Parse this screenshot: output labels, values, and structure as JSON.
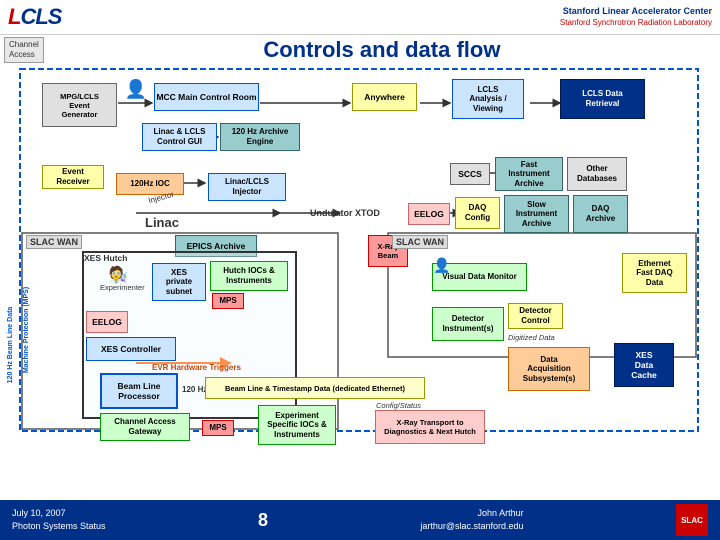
{
  "header": {
    "logo_text": "LCLS",
    "slac_line1": "Stanford Linear Accelerator Center",
    "slac_line2": "Stanford Synchrotron Radiation Laboratory"
  },
  "channel_access_label": "Channel\nAccess",
  "page_title": "Controls and data flow",
  "diagram": {
    "boxes": {
      "mpg_lcls": "MPG/LCLS\nEvent\nGenerator",
      "mcc_main": "MCC Main Control Room",
      "anywhere": "Anywhere",
      "lcls_analysis": "LCLS\nAnalysis /\nViewing",
      "lcls_data_retrieval": "LCLS Data\nRetrieval",
      "linac_lcls_gui": "Linac & LCLS\nControl GUI",
      "archive_engine": "120 Hz Archive\nEngine",
      "event_receiver": "Event\nReceiver",
      "injector": "Injector",
      "ioc_120hz": "120Hz IOC",
      "linac_lcls_injector": "Linac/LCLS\nInjector",
      "sccs": "SCCS",
      "fast_instrument_archive": "Fast\nInstrument\nArchive",
      "other_databases": "Other\nDatabases",
      "eelog": "EELOG",
      "daq_config": "DAQ\nConfig",
      "slow_instrument_archive": "Slow\nInstrument\nArchive",
      "daq_archive": "DAQ\nArchive",
      "linac_label": "Linac",
      "undulator_xtod": "Undulator XTOD",
      "epics_archive": "EPICS Archive",
      "xray_beam": "X-Ray\nBeam",
      "slac_wan_left": "SLAC WAN",
      "slac_wan_right": "SLAC WAN",
      "xes_hutch": "XES Hutch",
      "experimenter": "Experimenter",
      "xes_private_subnet": "XES\nprivate\nsubnet",
      "hutch_iocs": "Hutch IOCs &\nInstruments",
      "mps_top": "MPS",
      "mps_bottom": "MPS",
      "visual_data_monitor": "Visual Data Monitor",
      "ethernet_fast_daq": "Ethernet\nFast DAQ\nData",
      "eelog2": "EELOG",
      "xes_controller": "XES Controller",
      "evr_hardware_triggers": "EVR Hardware Triggers",
      "detector_instruments": "Detector\nInstrument(s)",
      "detector_control": "Detector\nControl",
      "digitized_data": "Digitized\nData",
      "data_acquisition": "Data\nAcquisition\nSubsystem(s)",
      "xes_data_cache": "XES\nData\nCache",
      "beam_line_processor": "Beam Line\nProcessor",
      "120hz_label": "120 Hz",
      "beam_line_timestamp": "Beam Line & Timestamp Data (dedicated Ethernet)",
      "channel_access_gateway": "Channel Access\nGateway",
      "experiment_specific": "Experiment\nSpecific IOCs &\nInstruments",
      "config_status": "Config/Status",
      "xray_transport": "X-Ray Transport to\nDiagnostics & Next Hutch"
    }
  },
  "footer": {
    "date": "July 10, 2007",
    "subtitle": "Photon Systems Status",
    "page_number": "8",
    "author": "John Arthur",
    "email": "jarthur@slac.stanford.edu"
  }
}
